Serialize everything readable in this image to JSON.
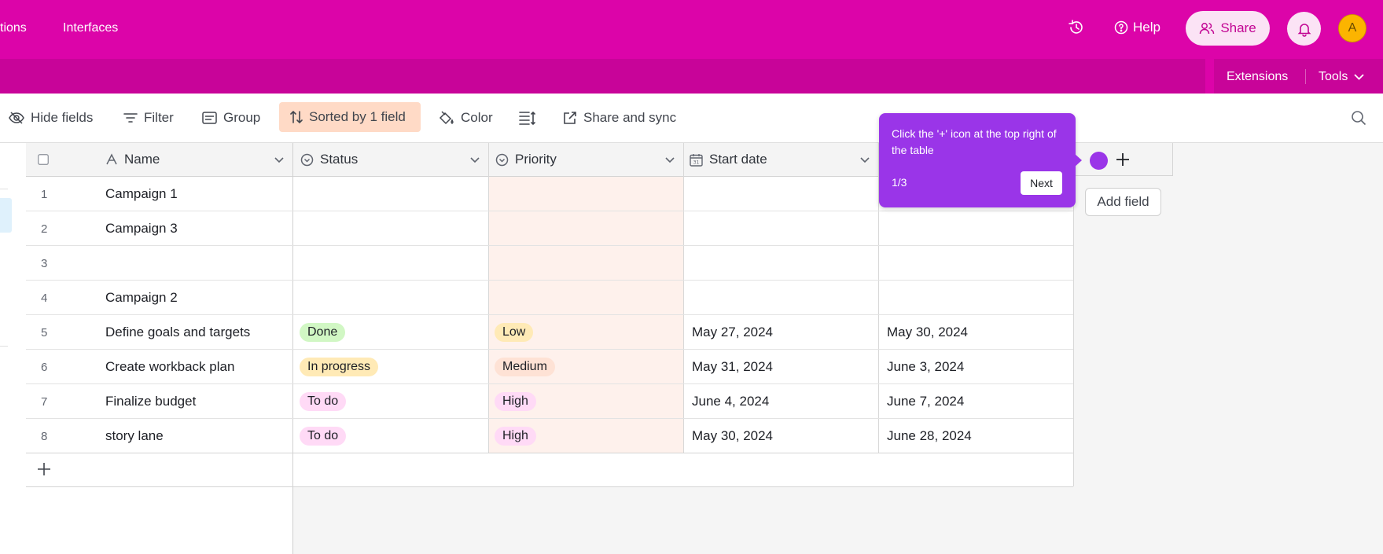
{
  "topbar": {
    "nav_items": [
      "tions",
      "Interfaces"
    ],
    "help_label": "Help",
    "share_label": "Share",
    "avatar_initial": "A",
    "bg_color": "#dc04a9"
  },
  "secondbar": {
    "extensions_label": "Extensions",
    "tools_label": "Tools"
  },
  "toolbar": {
    "hide_fields": "Hide fields",
    "filter": "Filter",
    "group": "Group",
    "sorted": "Sorted by 1 field",
    "color": "Color",
    "share_sync": "Share and sync"
  },
  "table": {
    "columns": [
      "Name",
      "Status",
      "Priority",
      "Start date"
    ],
    "add_field_tooltip": "Add field",
    "rows": [
      {
        "num": "1",
        "name": "Campaign 1",
        "status": "",
        "priority": "",
        "start": "",
        "end": ""
      },
      {
        "num": "2",
        "name": "Campaign 3",
        "status": "",
        "priority": "",
        "start": "",
        "end": ""
      },
      {
        "num": "3",
        "name": "",
        "status": "",
        "priority": "",
        "start": "",
        "end": ""
      },
      {
        "num": "4",
        "name": "Campaign 2",
        "status": "",
        "priority": "",
        "start": "",
        "end": ""
      },
      {
        "num": "5",
        "name": "Define goals and targets",
        "status": "Done",
        "priority": "Low",
        "start": "May 27, 2024",
        "end": "May 30, 2024"
      },
      {
        "num": "6",
        "name": "Create workback plan",
        "status": "In progress",
        "priority": "Medium",
        "start": "May 31, 2024",
        "end": "June 3, 2024"
      },
      {
        "num": "7",
        "name": "Finalize budget",
        "status": "To do",
        "priority": "High",
        "start": "June 4, 2024",
        "end": "June 7, 2024"
      },
      {
        "num": "8",
        "name": "story lane",
        "status": "To do",
        "priority": "High",
        "start": "May 30, 2024",
        "end": "June 28, 2024"
      }
    ],
    "status_colors": {
      "Done": "#d1f7c4",
      "In progress": "#ffeab6",
      "To do": "#ffdaf6"
    },
    "priority_colors": {
      "Low": "#ffeab6",
      "Medium": "#fee2d5",
      "High": "#ffdaf6"
    }
  },
  "guide": {
    "text": "Click the '+' icon at the top right of the table",
    "step": "1/3",
    "next_label": "Next",
    "color": "#9a35e8"
  }
}
